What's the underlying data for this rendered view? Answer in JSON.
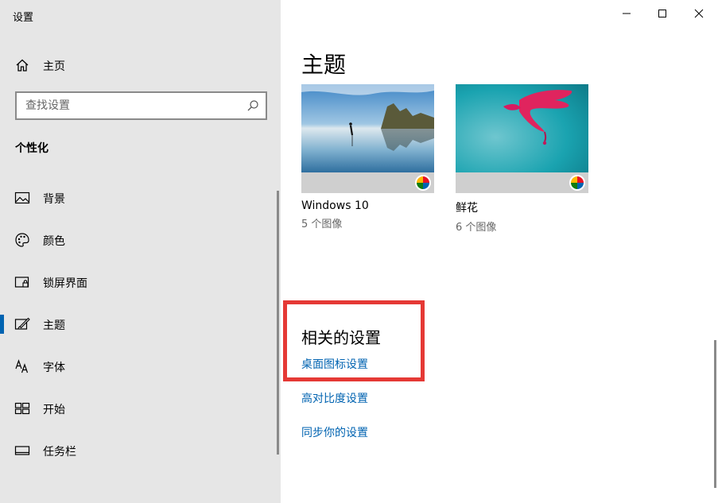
{
  "app": {
    "title": "设置"
  },
  "sidebar": {
    "home_label": "主页",
    "search": {
      "placeholder": "查找设置"
    },
    "section_title": "个性化",
    "items": [
      {
        "label": "背景",
        "icon": "picture-icon"
      },
      {
        "label": "颜色",
        "icon": "palette-icon"
      },
      {
        "label": "锁屏界面",
        "icon": "lock-screen-icon"
      },
      {
        "label": "主题",
        "icon": "theme-brush-icon",
        "active": true
      },
      {
        "label": "字体",
        "icon": "font-icon"
      },
      {
        "label": "开始",
        "icon": "start-tiles-icon"
      },
      {
        "label": "任务栏",
        "icon": "taskbar-icon"
      }
    ]
  },
  "window_controls": {
    "minimize": "minimize-icon",
    "maximize": "maximize-icon",
    "close": "close-icon"
  },
  "main": {
    "title": "主题",
    "themes": [
      {
        "name": "Windows 10",
        "count": "5 个图像"
      },
      {
        "name": "鲜花",
        "count": "6 个图像"
      }
    ],
    "related": {
      "title": "相关的设置",
      "links": [
        "桌面图标设置",
        "高对比度设置",
        "同步你的设置"
      ]
    }
  },
  "colors": {
    "accent": "#0063b1",
    "sidebar_bg": "#e6e6e6",
    "highlight": "#e53935"
  }
}
